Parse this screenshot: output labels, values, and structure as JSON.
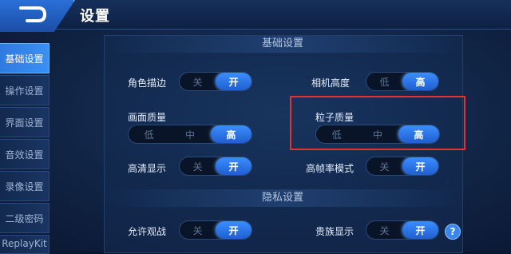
{
  "header": {
    "title": "设置"
  },
  "sidebar": {
    "items": [
      {
        "label": "基础设置",
        "active": true
      },
      {
        "label": "操作设置",
        "active": false
      },
      {
        "label": "界面设置",
        "active": false
      },
      {
        "label": "音效设置",
        "active": false
      },
      {
        "label": "录像设置",
        "active": false
      },
      {
        "label": "二级密码",
        "active": false
      },
      {
        "label": "ReplayKit",
        "active": false
      }
    ]
  },
  "sections": {
    "basic": "基础设置",
    "privacy": "隐私设置"
  },
  "settings": {
    "outline": {
      "label": "角色描边",
      "off": "关",
      "on": "开",
      "value": "开"
    },
    "camera_height": {
      "label": "相机高度",
      "low": "低",
      "high": "高",
      "value": "高"
    },
    "image_quality": {
      "label": "画面质量",
      "low": "低",
      "mid": "中",
      "high": "高",
      "value": "高"
    },
    "particle_quality": {
      "label": "粒子质量",
      "low": "低",
      "mid": "中",
      "high": "高",
      "value": "高"
    },
    "hd_display": {
      "label": "高清显示",
      "off": "关",
      "on": "开",
      "value": "开"
    },
    "high_fps": {
      "label": "高帧率模式",
      "off": "关",
      "on": "开",
      "value": "开"
    },
    "allow_spectate": {
      "label": "允许观战",
      "off": "关",
      "on": "开",
      "value": "开"
    },
    "noble_display": {
      "label": "贵族显示",
      "off": "关",
      "on": "开",
      "value": "开"
    }
  },
  "help": "?",
  "colors": {
    "accent": "#2f7ae0",
    "highlight": "#e5322e"
  }
}
